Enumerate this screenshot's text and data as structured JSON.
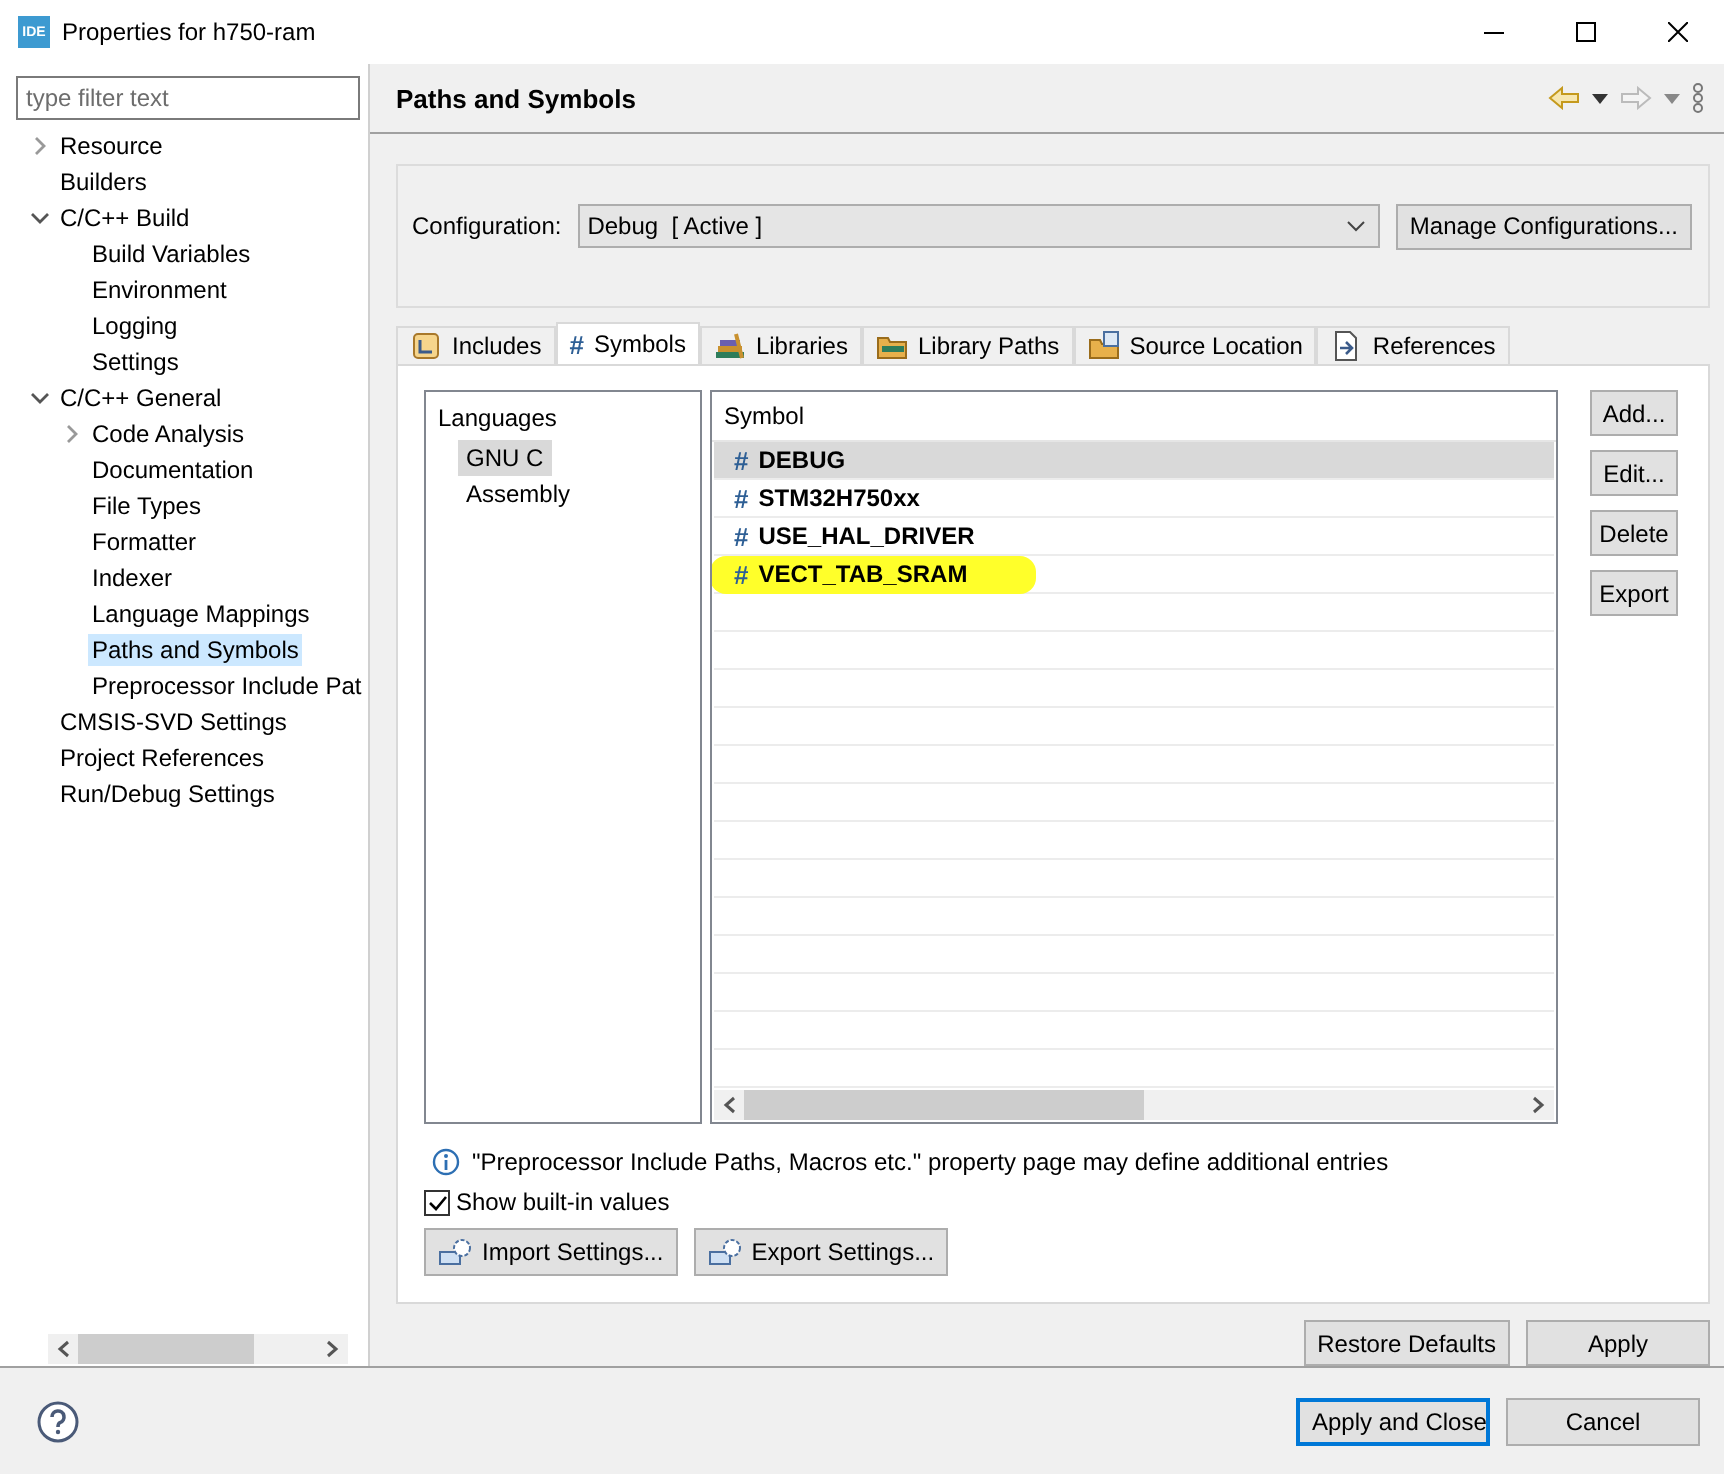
{
  "window": {
    "app_icon": "IDE",
    "title": "Properties for h750-ram"
  },
  "sidebar": {
    "filter": {
      "placeholder": "type filter text"
    },
    "tree": [
      {
        "label": "Resource",
        "expanded": false,
        "selected": false
      },
      {
        "label": "Builders",
        "selected": false
      },
      {
        "label": "C/C++ Build",
        "expanded": true,
        "selected": false,
        "children": [
          {
            "label": "Build Variables",
            "selected": false
          },
          {
            "label": "Environment",
            "selected": false
          },
          {
            "label": "Logging",
            "selected": false
          },
          {
            "label": "Settings",
            "selected": false
          }
        ]
      },
      {
        "label": "C/C++ General",
        "expanded": true,
        "selected": false,
        "children": [
          {
            "label": "Code Analysis",
            "expanded": false,
            "selected": false
          },
          {
            "label": "Documentation",
            "selected": false
          },
          {
            "label": "File Types",
            "selected": false
          },
          {
            "label": "Formatter",
            "selected": false
          },
          {
            "label": "Indexer",
            "selected": false
          },
          {
            "label": "Language Mappings",
            "selected": false
          },
          {
            "label": "Paths and Symbols",
            "selected": true
          },
          {
            "label": "Preprocessor Include Pat",
            "selected": false
          }
        ]
      },
      {
        "label": "CMSIS-SVD Settings",
        "selected": false
      },
      {
        "label": "Project References",
        "selected": false
      },
      {
        "label": "Run/Debug Settings",
        "selected": false
      }
    ]
  },
  "page": {
    "title": "Paths and Symbols"
  },
  "configuration": {
    "label": "Configuration:",
    "value": "Debug  [ Active ]",
    "manage_button": "Manage Configurations..."
  },
  "tabs": [
    {
      "label": "Includes",
      "selected": false
    },
    {
      "label": "Symbols",
      "glyph": "#",
      "selected": true
    },
    {
      "label": "Libraries",
      "selected": false
    },
    {
      "label": "Library Paths",
      "selected": false
    },
    {
      "label": "Source Location",
      "selected": false
    },
    {
      "label": "References",
      "selected": false
    }
  ],
  "languages": {
    "heading": "Languages",
    "items": [
      {
        "label": "GNU C",
        "selected": true
      },
      {
        "label": "Assembly",
        "selected": false
      }
    ]
  },
  "symbols": {
    "column": "Symbol",
    "rows": [
      {
        "glyph": "#",
        "name": "DEBUG",
        "selected": true,
        "highlighted": false
      },
      {
        "glyph": "#",
        "name": "STM32H750xx",
        "selected": false,
        "highlighted": false
      },
      {
        "glyph": "#",
        "name": "USE_HAL_DRIVER",
        "selected": false,
        "highlighted": false
      },
      {
        "glyph": "#",
        "name": "VECT_TAB_SRAM",
        "selected": false,
        "highlighted": true
      }
    ]
  },
  "side_buttons": [
    "Add...",
    "Edit...",
    "Delete",
    "Export"
  ],
  "info": "\"Preprocessor Include Paths, Macros etc.\" property page may define additional entries",
  "show_builtin": {
    "label": "Show built-in values",
    "checked": true
  },
  "settings_buttons": [
    "Import Settings...",
    "Export Settings..."
  ],
  "page_buttons": [
    "Restore Defaults",
    "Apply"
  ],
  "dialog_buttons": [
    {
      "label": "Apply and Close",
      "default": true
    },
    {
      "label": "Cancel",
      "default": false
    }
  ]
}
